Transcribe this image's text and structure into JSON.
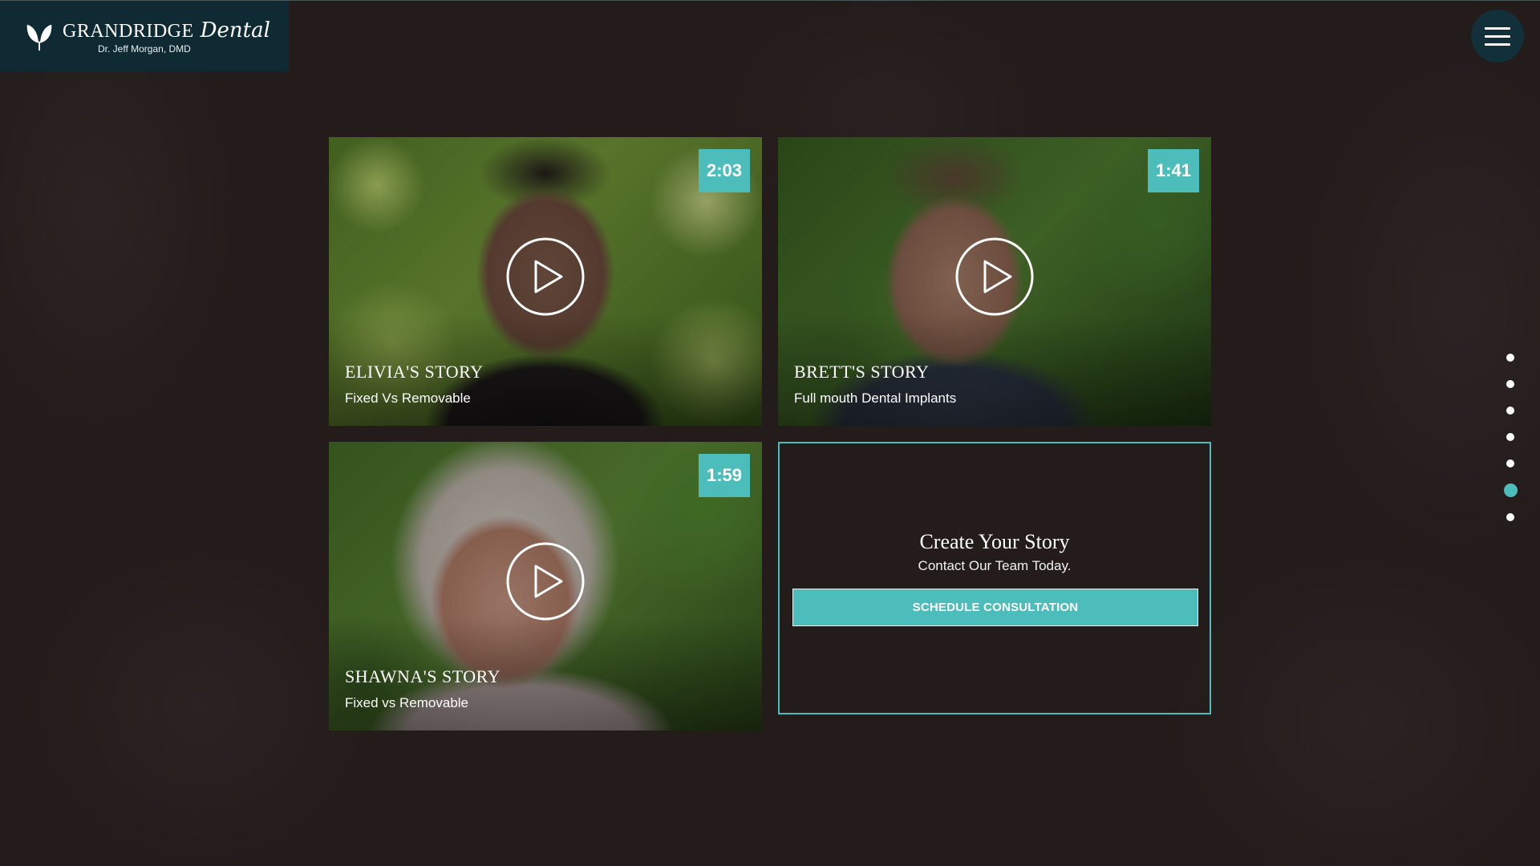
{
  "brand": {
    "name": "GRANDRIDGE",
    "script": "Dental",
    "doctor": "Dr. Jeff Morgan, DMD"
  },
  "menu": {
    "icon": "hamburger-menu-icon"
  },
  "stories": [
    {
      "title": "ELIVIA'S STORY",
      "subtitle": "Fixed Vs Removable",
      "duration": "2:03",
      "icon": "play-icon"
    },
    {
      "title": "BRETT'S STORY",
      "subtitle": "Full mouth Dental Implants",
      "duration": "1:41",
      "icon": "play-icon"
    },
    {
      "title": "SHAWNA'S STORY",
      "subtitle": "Fixed vs Removable",
      "duration": "1:59",
      "icon": "play-icon"
    }
  ],
  "cta": {
    "title": "Create Your Story",
    "subtitle": "Contact Our Team Today.",
    "button": "SCHEDULE CONSULTATION"
  },
  "pager": {
    "count": 7,
    "active_index": 5
  },
  "colors": {
    "accent": "#4dbdbb",
    "background": "#241b1b",
    "header": "#0f2a33"
  }
}
